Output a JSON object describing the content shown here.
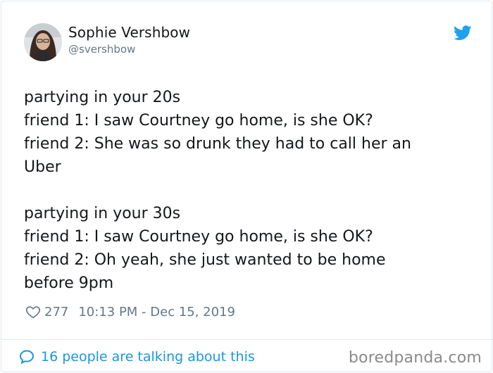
{
  "author": {
    "display_name": "Sophie Vershbow",
    "handle": "@svershbow"
  },
  "tweet": {
    "lines_block1": [
      "partying in your 20s",
      "friend 1: I saw Courtney go home, is she OK?",
      "friend 2: She was so drunk they had to call her an",
      "Uber"
    ],
    "lines_block2": [
      "partying in your 30s",
      "friend 1: I saw Courtney go home, is she OK?",
      "friend 2: Oh yeah, she just wanted to be home",
      "before 9pm"
    ]
  },
  "meta": {
    "likes": "277",
    "timestamp": "10:13 PM - Dec 15, 2019"
  },
  "footer": {
    "talking": "16 people are talking about this"
  },
  "watermark": "boredpanda.com",
  "colors": {
    "twitter_blue": "#1da1f2",
    "link_blue": "#1b95e0",
    "muted_gray": "#657786"
  },
  "icons": {
    "brand": "twitter-bird-icon",
    "like": "heart-icon",
    "replies": "speech-bubble-icon"
  }
}
